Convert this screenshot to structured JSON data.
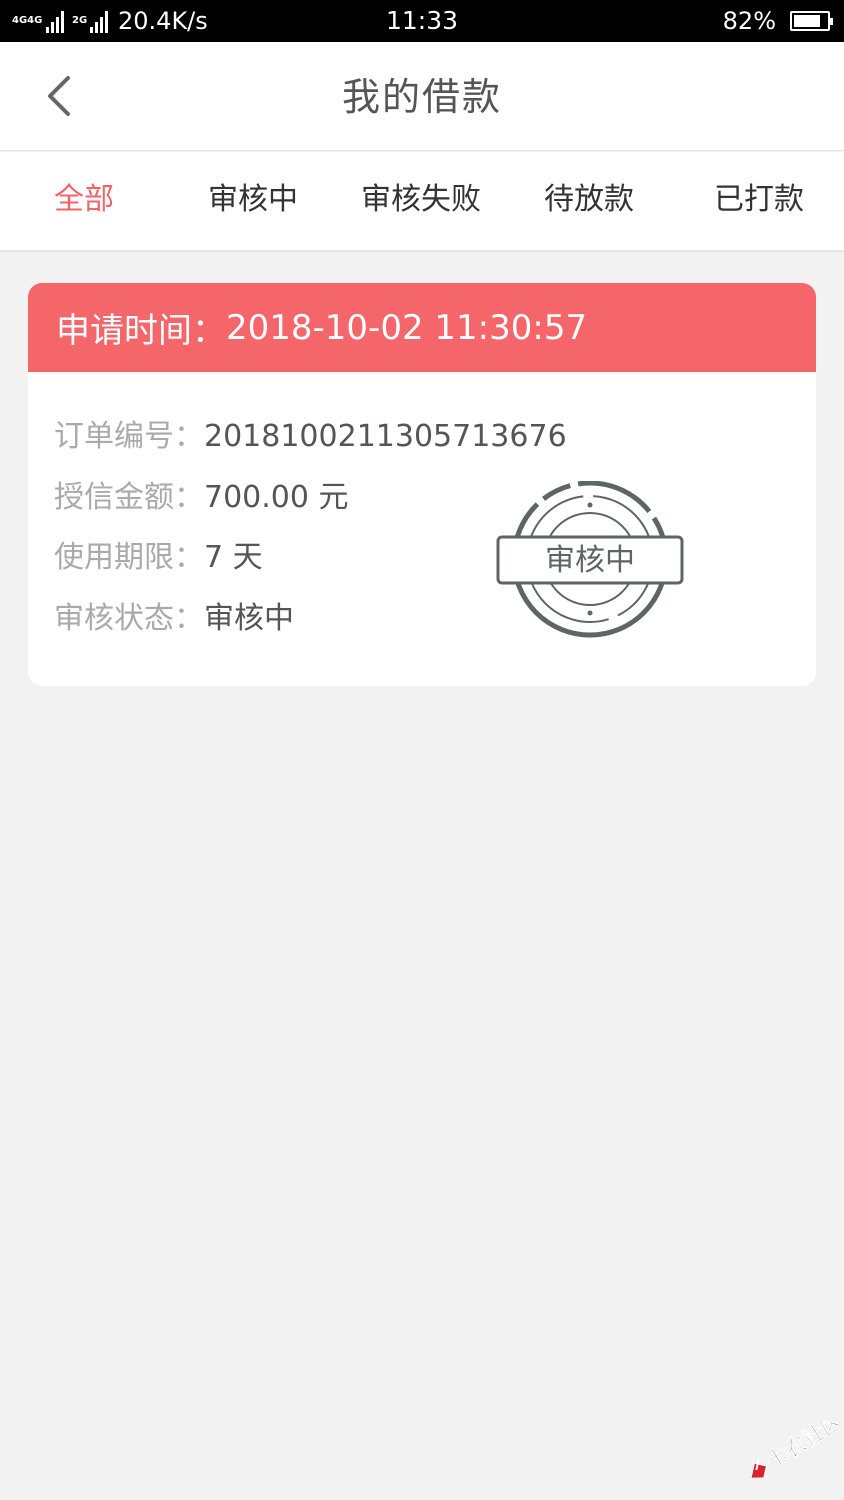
{
  "status_bar": {
    "network1": "4G",
    "network2": "4G",
    "network3": "2G",
    "speed": "20.4K/s",
    "time": "11:33",
    "battery_text": "82%",
    "battery_level": 0.82
  },
  "header": {
    "title": "我的借款"
  },
  "tabs": [
    {
      "label": "全部",
      "active": true
    },
    {
      "label": "审核中",
      "active": false
    },
    {
      "label": "审核失败",
      "active": false
    },
    {
      "label": "待放款",
      "active": false
    },
    {
      "label": "已打款",
      "active": false
    }
  ],
  "loan": {
    "apply_time_label": "申请时间：",
    "apply_time": "2018-10-02 11:30:57",
    "order_no_label": "订单编号：",
    "order_no": "201810021130571367​6",
    "credit_amount_label": "授信金额：",
    "credit_amount": "700.00 元",
    "term_label": "使用期限：",
    "term": "7 天",
    "status_label": "审核状态：",
    "status": "审核中",
    "stamp_text": "审核中"
  },
  "watermark": {
    "text": "卡农社区"
  },
  "colors": {
    "accent": "#f5666b",
    "active_tab": "#f2646a",
    "stamp": "#5e6566",
    "background": "#f2f2f2"
  }
}
